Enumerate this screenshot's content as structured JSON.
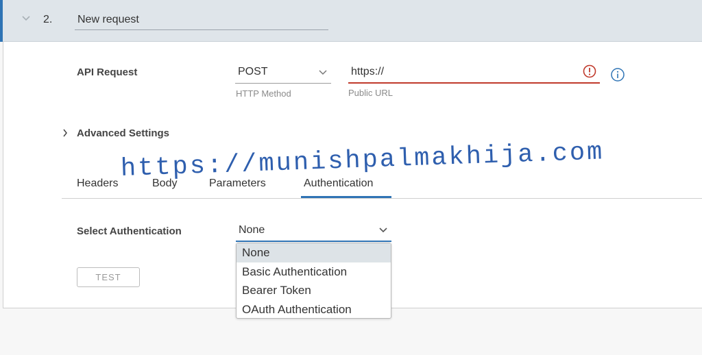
{
  "header": {
    "step": "2.",
    "request_name": "New request"
  },
  "api_request": {
    "label": "API Request",
    "method": "POST",
    "method_hint": "HTTP Method",
    "url": "https://",
    "url_hint": "Public URL"
  },
  "advanced": {
    "label": "Advanced Settings"
  },
  "tabs": [
    "Headers",
    "Body",
    "Parameters",
    "Authentication"
  ],
  "auth": {
    "label": "Select Authentication",
    "selected": "None",
    "options": [
      "None",
      "Basic Authentication",
      "Bearer Token",
      "OAuth Authentication"
    ]
  },
  "test_button": "TEST",
  "watermark": "https://munishpalmakhija.com",
  "colors": {
    "accent": "#2f74b5",
    "error": "#c0392b",
    "header_bg": "#dfe5ea"
  }
}
